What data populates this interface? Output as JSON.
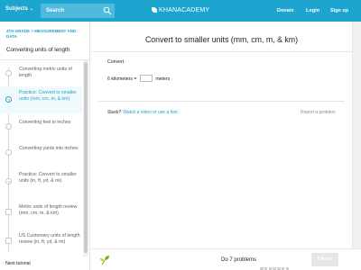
{
  "header": {
    "subjects_label": "Subjects",
    "search_placeholder": "Search",
    "logo_text": "KHANACADEMY",
    "donate_label": "Donate",
    "login_label": "Login",
    "signup_label": "Sign up"
  },
  "sidebar": {
    "breadcrumb": "4TH GRADE > MEASUREMENT AND DATA",
    "unit_title": "Converting units of length",
    "items": [
      {
        "label": "Converting metric units of length",
        "kind": "video"
      },
      {
        "label": "Practice: Convert to smaller units (mm, cm, m, & km)",
        "kind": "exercise",
        "active": true
      },
      {
        "label": "Converting feet to inches",
        "kind": "video"
      },
      {
        "label": "Converting yards into inches",
        "kind": "video"
      },
      {
        "label": "Practice: Convert to smaller units (in, ft, yd, & mi)",
        "kind": "exercise"
      },
      {
        "label": "Metric units of length review (mm, cm, m, & km)",
        "kind": "article"
      },
      {
        "label": "US Customary units of length review (in, ft, yd, & mi)",
        "kind": "article"
      }
    ],
    "next_tutorial": "Next tutorial"
  },
  "exercise": {
    "title": "Convert to smaller units (mm, cm, m, & km)",
    "instruction": "Convert.",
    "question_left": "6 kilometers =",
    "question_unit": "meters",
    "answer_value": "",
    "stuck_label": "Stuck?",
    "hint_link": "Watch a video or use a hint.",
    "report_label": "Report a problem"
  },
  "footer": {
    "progress_text": "Do 7 problems",
    "problem_count": 7,
    "check_label": "Check"
  },
  "colors": {
    "brand": "#1da4cf",
    "check_disabled": "#e4e6e8"
  }
}
